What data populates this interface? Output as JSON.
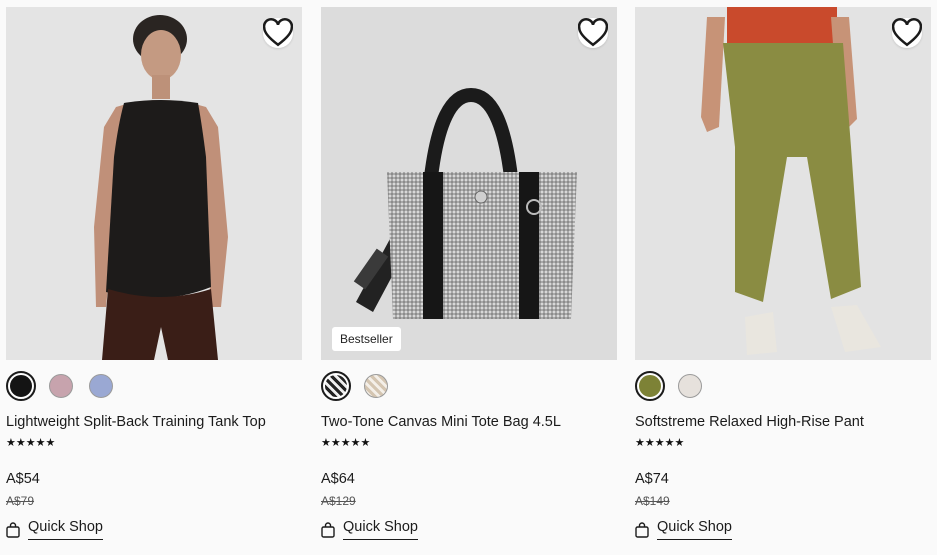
{
  "products": [
    {
      "name": "Lightweight Split-Back Training Tank Top",
      "rating": "★★★★★",
      "price": "A$54",
      "original_price": "A$79",
      "quick_shop": "Quick Shop",
      "swatches": [
        "#141414",
        "#c7a3ad",
        "#9aa8d3"
      ],
      "badge": ""
    },
    {
      "name": "Two-Tone Canvas Mini Tote Bag 4.5L",
      "rating": "★★★★★",
      "price": "A$64",
      "original_price": "A$129",
      "quick_shop": "Quick Shop",
      "swatches": [
        "pattern-bw",
        "pattern-cream"
      ],
      "badge": "Bestseller"
    },
    {
      "name": "Softstreme Relaxed High-Rise Pant",
      "rating": "★★★★★",
      "price": "A$74",
      "original_price": "A$149",
      "quick_shop": "Quick Shop",
      "swatches": [
        "#7d8236",
        "#e6e1dc"
      ],
      "badge": ""
    }
  ],
  "icons": {
    "wishlist": "heart-icon",
    "quick_shop": "shopping-bag-icon"
  }
}
